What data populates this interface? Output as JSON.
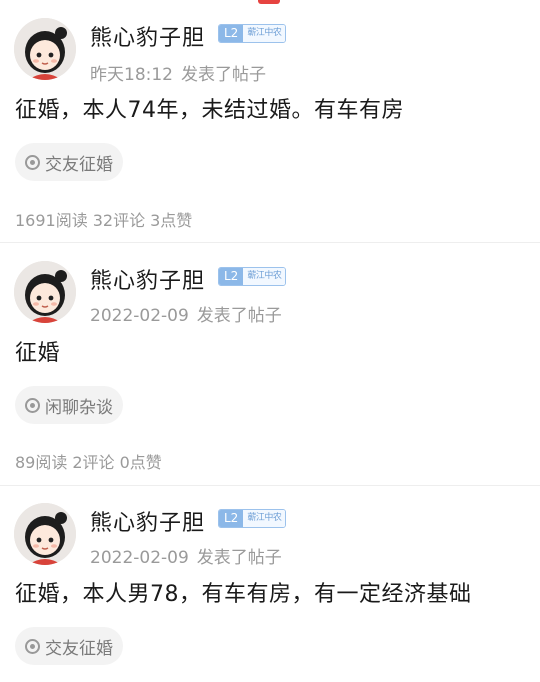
{
  "posts": [
    {
      "author": "熊心豹子胆",
      "level": "L2",
      "org": "蕲江中农",
      "time": "昨天18:12",
      "action": "发表了帖子",
      "content": "征婚，本人74年，未结过婚。有车有房",
      "tag": "交友征婚",
      "reads": "1691阅读",
      "comments": "32评论",
      "likes": "3点赞"
    },
    {
      "author": "熊心豹子胆",
      "level": "L2",
      "org": "蕲江中农",
      "time": "2022-02-09",
      "action": "发表了帖子",
      "content": "征婚",
      "tag": "闲聊杂谈",
      "reads": "89阅读",
      "comments": "2评论",
      "likes": "0点赞"
    },
    {
      "author": "熊心豹子胆",
      "level": "L2",
      "org": "蕲江中农",
      "time": "2022-02-09",
      "action": "发表了帖子",
      "content": "征婚，本人男78，有车有房，有一定经济基础",
      "tag": "交友征婚"
    }
  ],
  "icons": {
    "avatar": "cartoon-girl-avatar",
    "tag": "topic-circle-icon"
  },
  "colors": {
    "accent_badge": "#8cb8e8",
    "notice": "#e64340"
  }
}
